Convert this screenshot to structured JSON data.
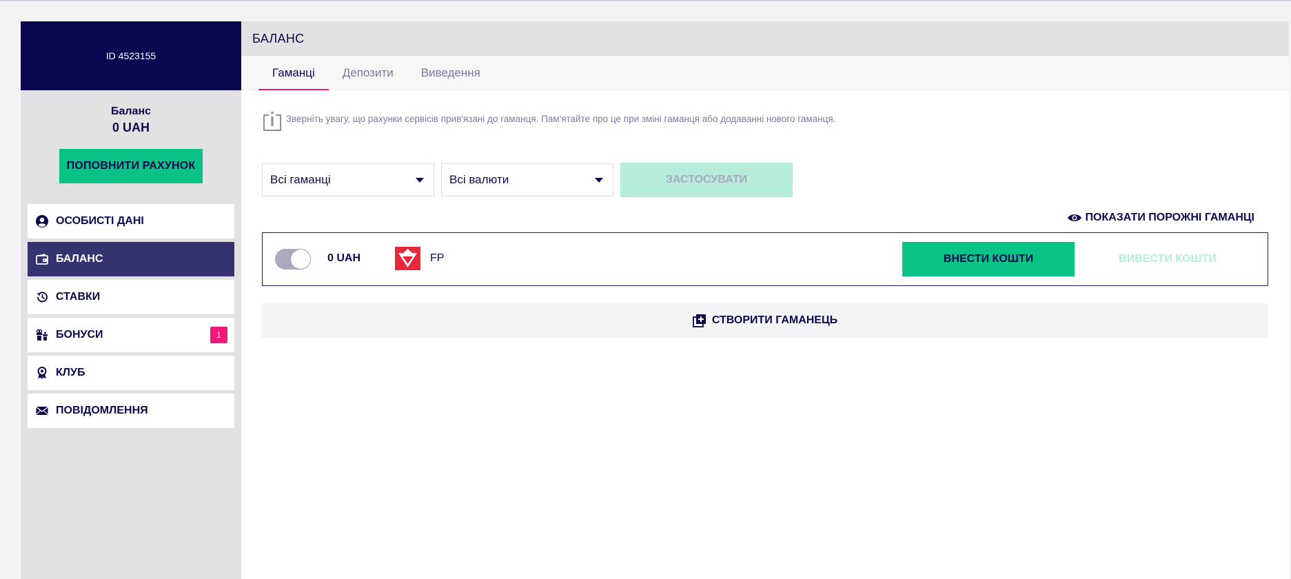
{
  "user": {
    "id_label": "ID 4523155"
  },
  "balance": {
    "label": "Баланс",
    "value": "0 UAH",
    "topup_label": "ПОПОВНИТИ РАХУНОК"
  },
  "sidebar": {
    "items": [
      {
        "label": "ОСОБИСТІ ДАНІ",
        "icon": "user-circle-icon",
        "active": false
      },
      {
        "label": "БАЛАНС",
        "icon": "wallet-icon",
        "active": true
      },
      {
        "label": "СТАВКИ",
        "icon": "history-icon",
        "active": false
      },
      {
        "label": "БОНУСИ",
        "icon": "gift-icon",
        "active": false,
        "badge": "1"
      },
      {
        "label": "КЛУБ",
        "icon": "award-icon",
        "active": false
      },
      {
        "label": "ПОВІДОМЛЕННЯ",
        "icon": "envelope-icon",
        "active": false
      }
    ]
  },
  "header": {
    "title": "БАЛАНС"
  },
  "tabs": [
    {
      "label": "Гаманці",
      "active": true
    },
    {
      "label": "Депозити",
      "active": false
    },
    {
      "label": "Виведення",
      "active": false
    }
  ],
  "notice": {
    "text": "Зверніть увагу, що рахунки сервісів прив'язані до гаманця. Пам'ятайте про це при зміні гаманця або додаванні нового гаманця."
  },
  "filters": {
    "wallet_select": "Всі гаманці",
    "currency_select": "Всі валюти",
    "apply_label": "ЗАСТОСУВАТИ"
  },
  "show_empty_label": "ПОКАЗАТИ ПОРОЖНІ ГАМАНЦІ",
  "wallet": {
    "amount": "0 UAH",
    "name": "FP",
    "deposit_label": "ВНЕСТИ КОШТИ",
    "withdraw_label": "ВИВЕСТИ КОШТИ"
  },
  "create_wallet_label": "СТВОРИТИ ГАМАНЕЦЬ",
  "colors": {
    "brand_dark": "#08074f",
    "accent_green": "#08c286",
    "accent_pink": "#f0167a",
    "active_menu": "#34336f"
  }
}
